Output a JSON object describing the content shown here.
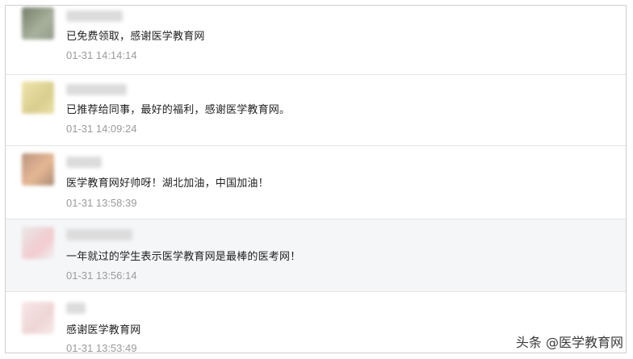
{
  "comments": [
    {
      "text": "已免费领取，感谢医学教育网",
      "time": "01-31 14:14:14",
      "avatar_colors": [
        "#6d7a64",
        "#a4ad97"
      ]
    },
    {
      "text": "已推荐给同事，最好的福利，感谢医学教育网。",
      "time": "01-31 14:09:24",
      "avatar_colors": [
        "#efe4a6",
        "#d8cc8a"
      ]
    },
    {
      "text": "医学教育网好帅呀！湖北加油，中国加油！",
      "time": "01-31 13:58:39",
      "avatar_colors": [
        "#c9a184",
        "#e4b48e"
      ]
    },
    {
      "text": "一年就过的学生表示医学教育网是最棒的医考网！",
      "time": "01-31 13:56:14",
      "avatar_colors": [
        "#f1f1f1",
        "#f3c9cc"
      ]
    },
    {
      "text": "感谢医学教育网",
      "time": "01-31 13:53:49",
      "avatar_colors": [
        "#f7e6e6",
        "#efd3d3"
      ]
    }
  ],
  "watermark": "头条 @医学教育网"
}
